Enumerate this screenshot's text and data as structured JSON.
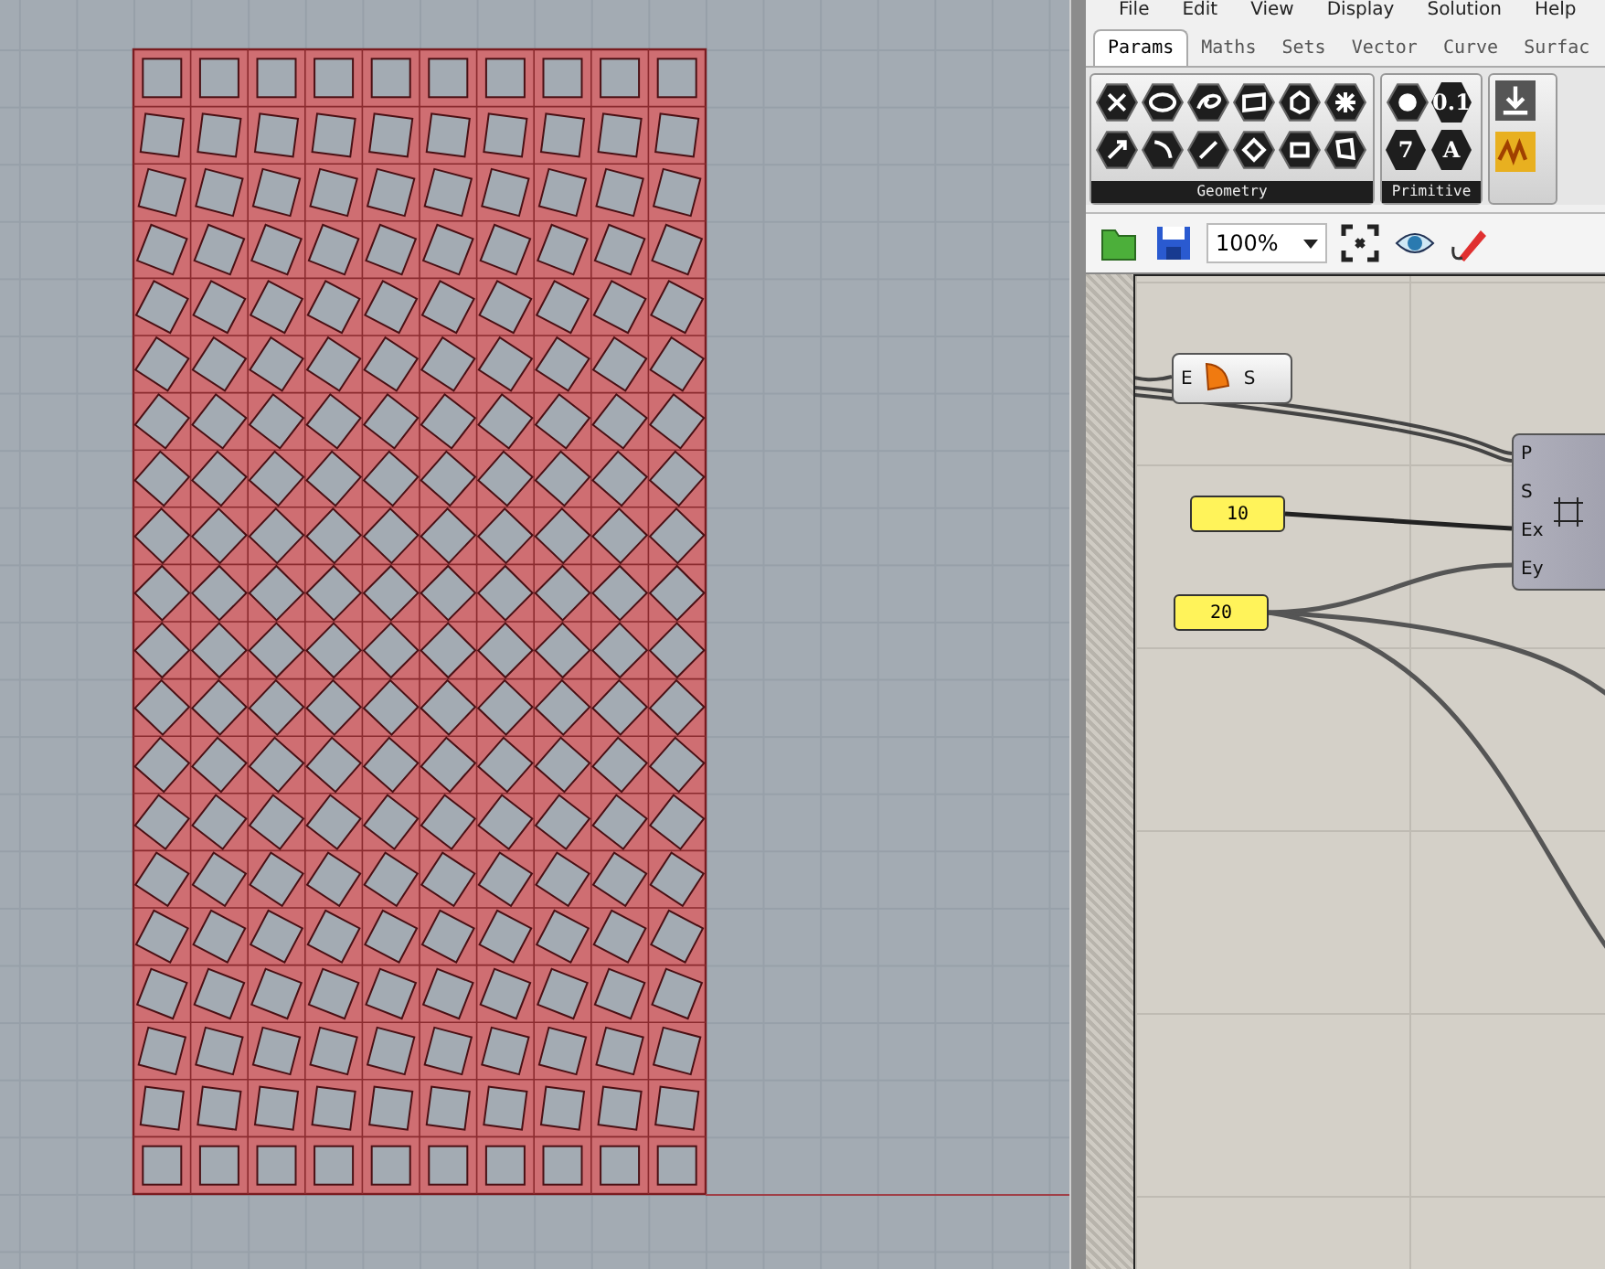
{
  "menu": [
    "File",
    "Edit",
    "View",
    "Display",
    "Solution",
    "Help"
  ],
  "tabs": [
    {
      "label": "Params",
      "selected": true
    },
    {
      "label": "Maths",
      "selected": false
    },
    {
      "label": "Sets",
      "selected": false
    },
    {
      "label": "Vector",
      "selected": false
    },
    {
      "label": "Curve",
      "selected": false
    },
    {
      "label": "Surfac",
      "selected": false
    }
  ],
  "panels": [
    {
      "title": "Geometry"
    },
    {
      "title": "Primitive",
      "glyphs": [
        "0.1",
        "7",
        "A"
      ]
    }
  ],
  "zoom": {
    "value": "100%"
  },
  "canvas": {
    "nodes": [
      {
        "kind": "component",
        "inputs": [
          "E"
        ],
        "outputs": [
          "S"
        ]
      },
      {
        "kind": "slider",
        "value": "10"
      },
      {
        "kind": "component",
        "inputs": [
          "P",
          "S",
          "Ex",
          "Ey"
        ]
      },
      {
        "kind": "slider",
        "value": "20"
      }
    ]
  }
}
